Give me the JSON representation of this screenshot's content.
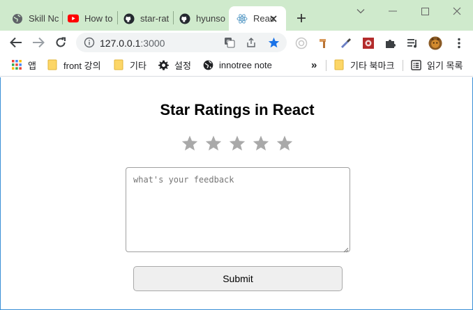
{
  "browser": {
    "tabs": [
      {
        "title": "Skill Nc",
        "icon": "globe-icon",
        "active": false
      },
      {
        "title": "How to",
        "icon": "youtube-icon",
        "active": false
      },
      {
        "title": "star-rat",
        "icon": "github-icon",
        "active": false
      },
      {
        "title": "hyunso",
        "icon": "github-icon",
        "active": false
      },
      {
        "title": "Reac",
        "icon": "react-icon",
        "active": true
      }
    ],
    "new_tab_label": "+",
    "address_bar": {
      "url_host": "127.0.0.1",
      "url_port": ":3000"
    },
    "bookmarks": [
      {
        "label": "앱",
        "icon": "apps-grid-icon"
      },
      {
        "label": "front 강의",
        "icon": "folder-icon"
      },
      {
        "label": "기타",
        "icon": "folder-icon"
      },
      {
        "label": "설정",
        "icon": "gear-icon"
      },
      {
        "label": "innotree note",
        "icon": "globe-icon"
      }
    ],
    "bookmarks_overflow": "»",
    "bookmarks_right": [
      {
        "label": "기타 북마크",
        "icon": "folder-icon"
      },
      {
        "label": "읽기 목록",
        "icon": "reading-list-icon"
      }
    ],
    "colors": {
      "tabstrip": "#cfeacc",
      "star_bookmark": "#1a73e8"
    }
  },
  "app": {
    "title": "Star Ratings in React",
    "star_count": 5,
    "rating": 0,
    "star_color": "#a9a9a9",
    "feedback": {
      "placeholder": "what's your feedback",
      "value": ""
    },
    "submit_label": "Submit"
  }
}
